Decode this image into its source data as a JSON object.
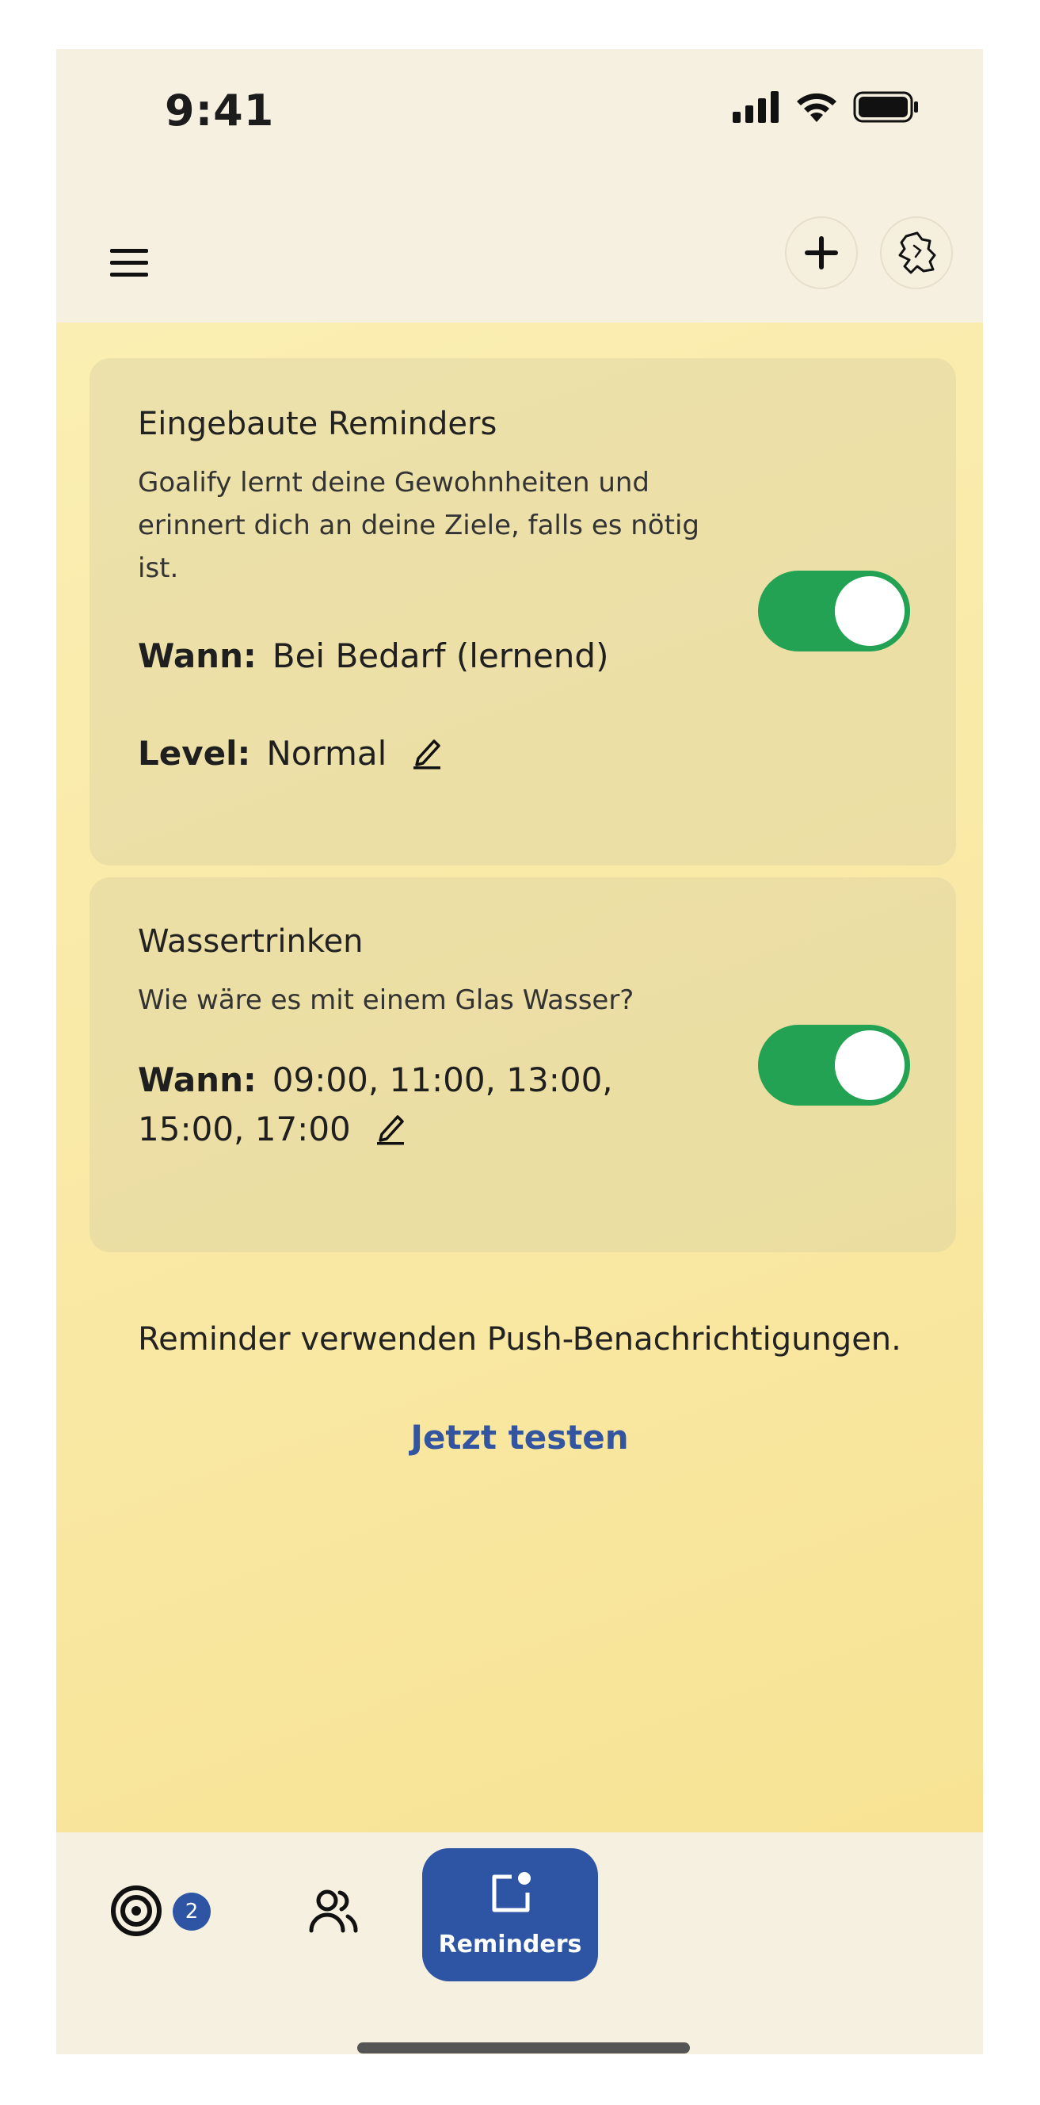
{
  "status_bar": {
    "time": "9:41",
    "icons": [
      "signal-icon",
      "wifi-icon",
      "battery-icon"
    ]
  },
  "header": {
    "menu_icon": "hamburger-icon",
    "add_icon": "plus-icon",
    "avatar_icon": "avatar-icon"
  },
  "reminders": [
    {
      "title": "Eingebaute Reminders",
      "description": "Goalify lernt deine Gewohnheiten und erinnert dich an deine Ziele, falls es nötig ist.",
      "when_label": "Wann:",
      "when_value": "Bei Bedarf (lernend)",
      "level_label": "Level:",
      "level_value": "Normal",
      "enabled": true
    },
    {
      "title": "Wassertrinken",
      "description": "Wie wäre es mit einem Glas Wasser?",
      "when_label": "Wann:",
      "when_value": "09:00, 11:00, 13:00, 15:00, 17:00",
      "enabled": true
    }
  ],
  "info": {
    "push_text": "Reminder verwenden Push-Benachrichtigungen.",
    "test_link": "Jetzt testen"
  },
  "tabbar": {
    "goals_badge": "2",
    "reminders_label": "Reminders"
  },
  "colors": {
    "accent_blue": "#2d55a3",
    "toggle_green": "#22a252",
    "background_yellow": "#f9e8a3"
  }
}
